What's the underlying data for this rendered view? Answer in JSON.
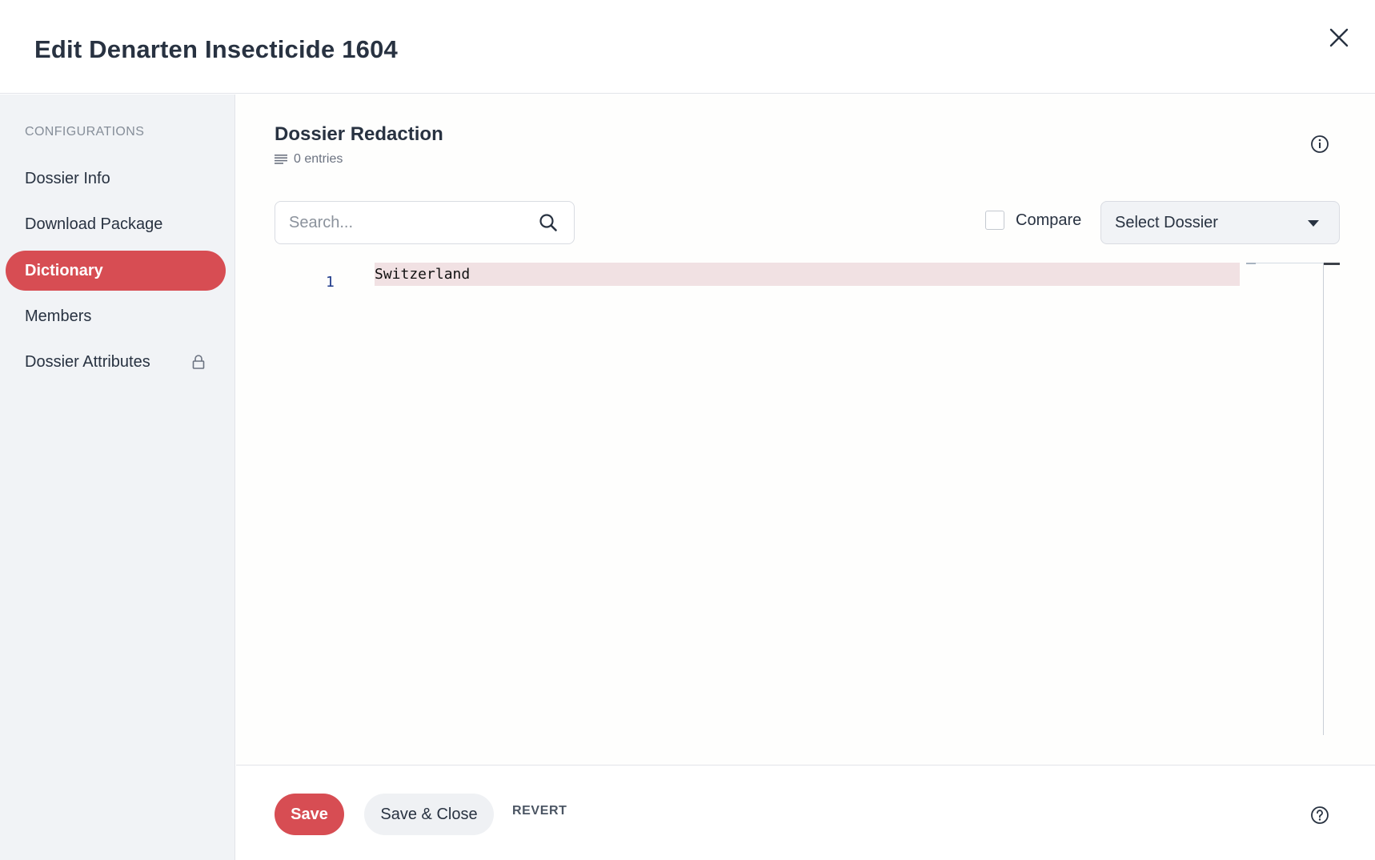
{
  "header": {
    "title": "Edit Denarten Insecticide 1604",
    "close_icon": "close-icon"
  },
  "sidebar": {
    "heading": "CONFIGURATIONS",
    "items": [
      {
        "label": "Dossier Info",
        "active": false
      },
      {
        "label": "Download Package",
        "active": false
      },
      {
        "label": "Dictionary",
        "active": true
      },
      {
        "label": "Members",
        "active": false
      },
      {
        "label": "Dossier Attributes",
        "active": false,
        "icon": "lock-icon"
      }
    ]
  },
  "main": {
    "title": "Dossier Redaction",
    "entries": "0 entries",
    "search": {
      "placeholder": "Search...",
      "value": ""
    },
    "compare": {
      "label": "Compare",
      "checked": false
    },
    "select": {
      "value": "Select Dossier"
    },
    "editor": {
      "lines": [
        {
          "number": "1",
          "text": "Switzerland"
        }
      ]
    }
  },
  "footer": {
    "save_label": "Save",
    "save_close_label": "Save & Close",
    "revert_label": "REVERT"
  },
  "colors": {
    "accent": "#d74d53",
    "sidebar_bg": "#f1f3f6",
    "line_highlight": "#f1e1e3"
  }
}
